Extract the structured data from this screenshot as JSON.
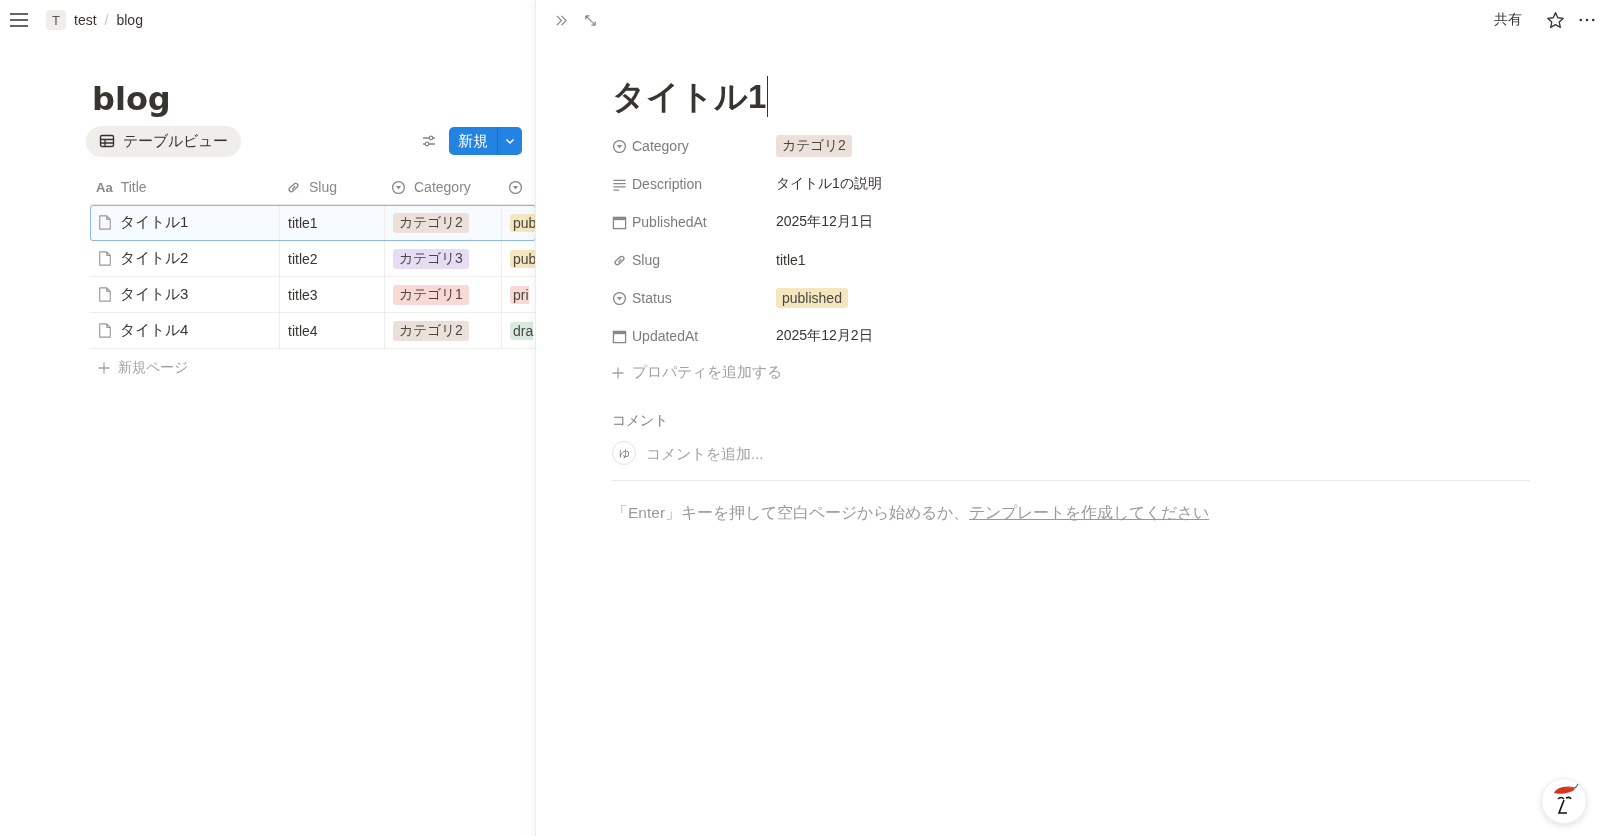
{
  "breadcrumb": {
    "workspace_initial": "T",
    "items": [
      "test",
      "blog"
    ],
    "separator": "/"
  },
  "database": {
    "title": "blog",
    "view_tab": {
      "label": "テーブルビュー",
      "selected": true
    },
    "new_button": "新規",
    "columns": [
      {
        "kind": "title",
        "icon_text": "Aa",
        "label": "Title"
      },
      {
        "kind": "link",
        "label": "Slug"
      },
      {
        "kind": "select",
        "label": "Category"
      },
      {
        "kind": "select"
      }
    ],
    "rows": [
      {
        "title": "タイトル1",
        "slug": "title1",
        "category": {
          "label": "カテゴリ2",
          "color": "#ebe1da"
        },
        "status": {
          "label": "pub",
          "color": "#f4e6bd"
        },
        "selected": true
      },
      {
        "title": "タイトル2",
        "slug": "title2",
        "category": {
          "label": "カテゴリ3",
          "color": "#e8dcf5"
        },
        "status": {
          "label": "pub",
          "color": "#f4e6bd"
        },
        "selected": false
      },
      {
        "title": "タイトル3",
        "slug": "title3",
        "category": {
          "label": "カテゴリ1",
          "color": "#f9d9d5"
        },
        "status": {
          "label": "pri",
          "color": "#f9d9d5"
        },
        "selected": false
      },
      {
        "title": "タイトル4",
        "slug": "title4",
        "category": {
          "label": "カテゴリ2",
          "color": "#ebe1da"
        },
        "status": {
          "label": "dra",
          "color": "#d9eadf"
        },
        "selected": false
      }
    ],
    "add_row": "新規ページ"
  },
  "page": {
    "share": "共有",
    "title": "タイトル1",
    "properties": [
      {
        "kind": "select",
        "label": "Category",
        "value": "カテゴリ2",
        "color": "#ebe1da"
      },
      {
        "kind": "text",
        "label": "Description",
        "value": "タイトル1の説明"
      },
      {
        "kind": "date",
        "label": "PublishedAt",
        "value": "2025年12月1日"
      },
      {
        "kind": "link",
        "label": "Slug",
        "value": "title1"
      },
      {
        "kind": "select",
        "label": "Status",
        "value": "published",
        "color": "#f4e6bd"
      },
      {
        "kind": "date",
        "label": "UpdatedAt",
        "value": "2025年12月2日"
      }
    ],
    "add_property": "プロパティを追加する",
    "comments": {
      "heading": "コメント",
      "avatar_letter": "ゆ",
      "placeholder": "コメントを追加..."
    },
    "empty_hint": {
      "text": "「Enter」キーを押して空白ページから始めるか、",
      "link": "テンプレートを作成してください"
    }
  }
}
